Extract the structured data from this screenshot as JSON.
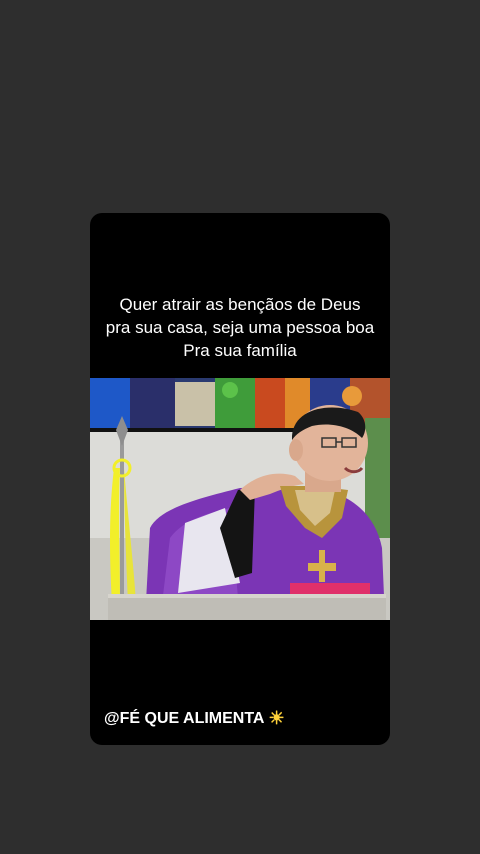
{
  "post": {
    "caption_lines": [
      "Quer atrair as bençãos de Deus",
      "pra sua casa, seja uma pessoa boa",
      "Pra sua família"
    ],
    "watermark": "@FÉ QUE ALIMENTA",
    "watermark_icon": "sun-icon"
  },
  "colors": {
    "background": "#2e2e2e",
    "card": "#000000",
    "vestment": "#7b35b5"
  }
}
